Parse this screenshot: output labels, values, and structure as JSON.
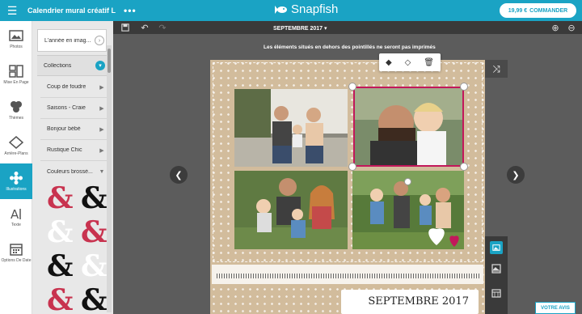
{
  "header": {
    "title": "Calendrier mural créatif L",
    "more_label": "•••",
    "logo_text": "Snapfish",
    "price": "19,99 €",
    "order_label": "COMMANDER"
  },
  "iconbar": [
    {
      "label": "Photos",
      "icon": "photo-icon"
    },
    {
      "label": "Mise En Page",
      "icon": "layout-icon"
    },
    {
      "label": "Thèmes",
      "icon": "theme-icon"
    },
    {
      "label": "Arrière-Plans",
      "icon": "background-icon"
    },
    {
      "label": "Illustrations",
      "icon": "illustration-icon",
      "active": true
    },
    {
      "label": "Texte",
      "icon": "text-icon"
    },
    {
      "label": "Options De Date",
      "icon": "calendar-icon"
    }
  ],
  "panel": {
    "top_item": "L'année en imag...",
    "collections": "Collections",
    "sub_items": [
      "Coup de foudre",
      "Saisons - Craie",
      "Bonjour bébé",
      "Rustique Chic",
      "Couleurs brossé..."
    ]
  },
  "toolbar": {
    "month_selector": "SEPTEMBRE 2017",
    "hint": "Les éléments situés en dehors des pointillés ne seront pas imprimés"
  },
  "calendar": {
    "month_title": "SEPTEMBRE 2017"
  },
  "feedback": {
    "label": "VOTRE AVIS"
  },
  "colors": {
    "accent": "#1aa3c4",
    "selection": "#c2185b",
    "amp_red": "#c8334f",
    "amp_black": "#111111"
  }
}
